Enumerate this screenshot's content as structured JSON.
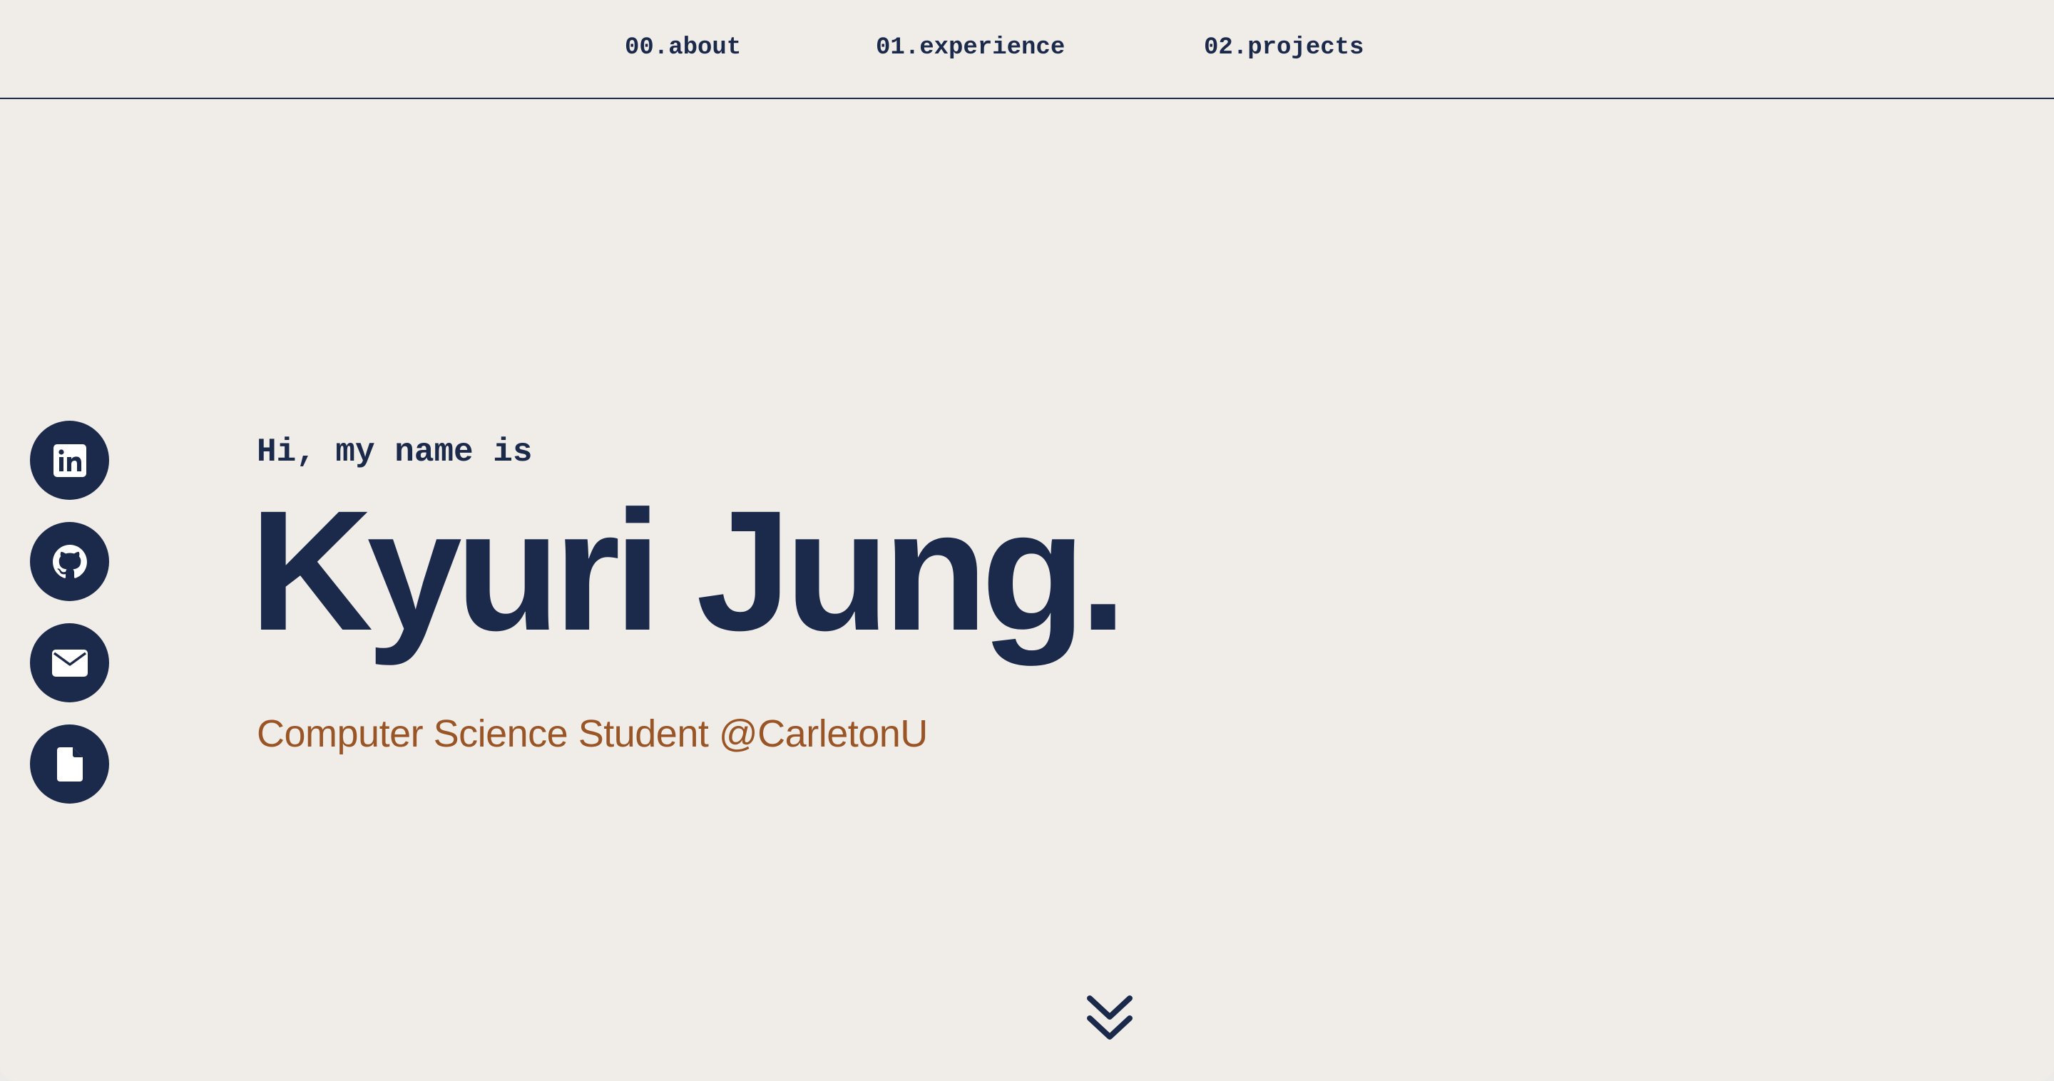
{
  "nav": {
    "items": [
      {
        "label": "00.about"
      },
      {
        "label": "01.experience"
      },
      {
        "label": "02.projects"
      }
    ]
  },
  "socials": [
    {
      "icon": "linkedin-icon"
    },
    {
      "icon": "github-icon"
    },
    {
      "icon": "mail-icon"
    },
    {
      "icon": "file-icon"
    }
  ],
  "hero": {
    "greeting": "Hi, my name is",
    "name": "Kyuri Jung.",
    "subtitle": "Computer Science Student @CarletonU"
  },
  "colors": {
    "background": "#f0ece8",
    "navy": "#1b2a4a",
    "accent": "#9a5527"
  },
  "scroll_icon": "chevrons-down-icon"
}
